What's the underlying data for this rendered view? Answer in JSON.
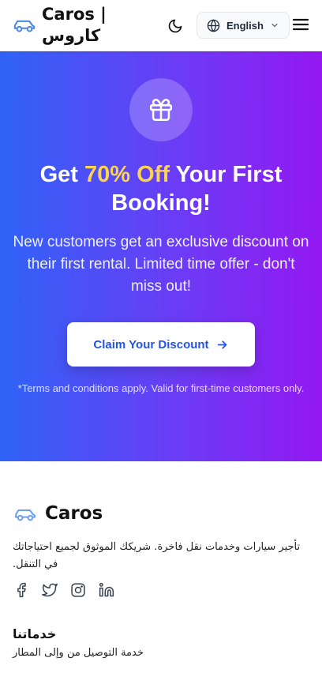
{
  "header": {
    "brand": "Caros | كاروس",
    "language": "English",
    "icons": {
      "logo": "car-icon",
      "theme": "moon-icon",
      "language": "globe-icon",
      "dropdown": "chevron-down-icon",
      "menu": "hamburger-menu-icon"
    }
  },
  "hero": {
    "title_prefix": "Get",
    "title_accent": "70% Off",
    "title_suffix": "Your First Booking!",
    "subtitle": "New customers get an exclusive discount on their first rental. Limited time offer - don't miss out!",
    "cta_label": "Claim Your Discount",
    "terms": "*Terms and conditions apply. Valid for first-time customers only.",
    "icons": {
      "badge": "gift-icon",
      "cta": "arrow-right-icon"
    },
    "colors": {
      "gradient_start": "#2f63f7",
      "gradient_end": "#9418f2",
      "accent": "#fcd34d",
      "cta_text": "#2453e8"
    }
  },
  "footer": {
    "brand": "Caros",
    "description": "تأجير سيارات وخدمات نقل فاخرة. شريكك الموثوق لجميع احتياجاتك في التنقل.",
    "social_icons": [
      "facebook-icon",
      "twitter-icon",
      "instagram-icon",
      "linkedin-icon"
    ],
    "services_heading": "خدماتنا",
    "services": [
      "خدمة التوصيل من وإلى المطار"
    ]
  }
}
